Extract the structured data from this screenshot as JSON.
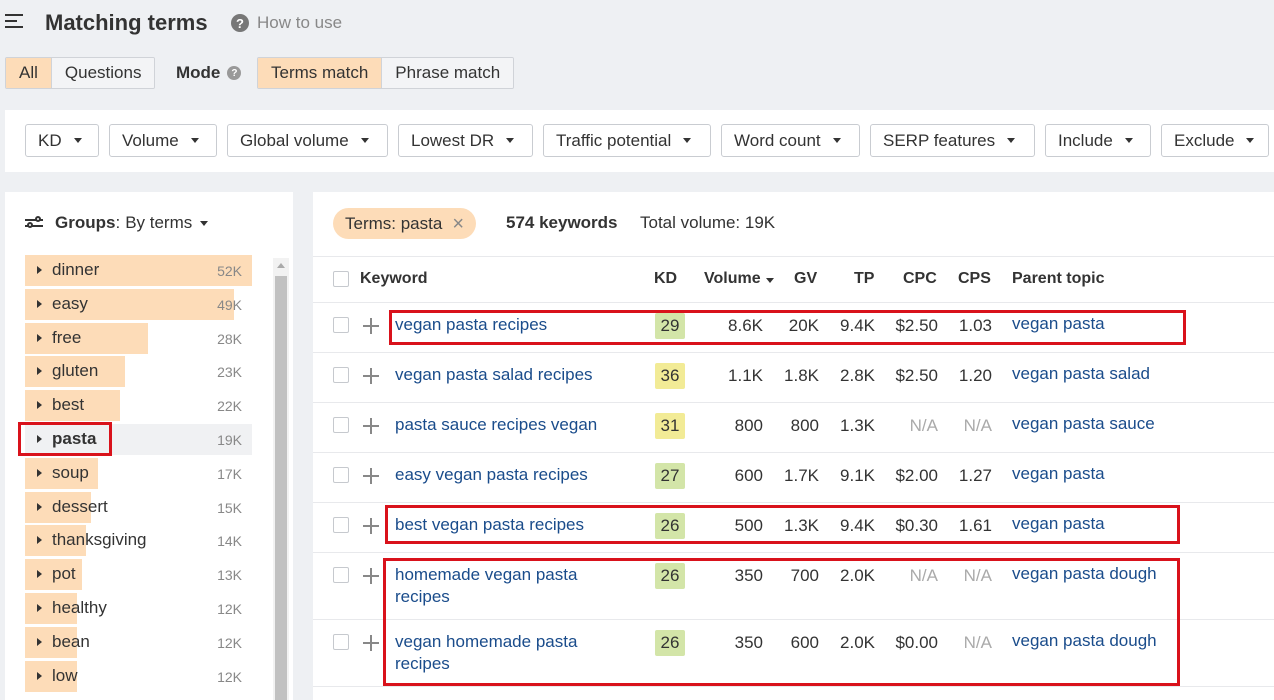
{
  "header": {
    "title": "Matching terms",
    "how_to_use": "How to use"
  },
  "scope_tabs": [
    "All",
    "Questions"
  ],
  "mode": {
    "label": "Mode",
    "options": [
      "Terms match",
      "Phrase match"
    ]
  },
  "filters": [
    "KD",
    "Volume",
    "Global volume",
    "Lowest DR",
    "Traffic potential",
    "Word count",
    "SERP features",
    "Include",
    "Exclude"
  ],
  "groups": {
    "label": "Groups",
    "value": "By terms",
    "items": [
      {
        "name": "dinner",
        "count": "52K",
        "fill": 1.0
      },
      {
        "name": "easy",
        "count": "49K",
        "fill": 0.92
      },
      {
        "name": "free",
        "count": "28K",
        "fill": 0.54
      },
      {
        "name": "gluten",
        "count": "23K",
        "fill": 0.44
      },
      {
        "name": "best",
        "count": "22K",
        "fill": 0.42
      },
      {
        "name": "pasta",
        "count": "19K",
        "fill": 0.37
      },
      {
        "name": "soup",
        "count": "17K",
        "fill": 0.32
      },
      {
        "name": "dessert",
        "count": "15K",
        "fill": 0.29
      },
      {
        "name": "thanksgiving",
        "count": "14K",
        "fill": 0.27
      },
      {
        "name": "pot",
        "count": "13K",
        "fill": 0.25
      },
      {
        "name": "healthy",
        "count": "12K",
        "fill": 0.23
      },
      {
        "name": "bean",
        "count": "12K",
        "fill": 0.23
      },
      {
        "name": "low",
        "count": "12K",
        "fill": 0.23
      }
    ]
  },
  "term_chip": "Terms: pasta",
  "keyword_count": "574 keywords",
  "total_volume": "Total volume: 19K",
  "columns": [
    "Keyword",
    "KD",
    "Volume",
    "GV",
    "TP",
    "CPC",
    "CPS",
    "Parent topic"
  ],
  "rows": [
    {
      "keyword": "vegan pasta recipes",
      "kd": "29",
      "volume": "8.6K",
      "gv": "20K",
      "tp": "9.4K",
      "cpc": "$2.50",
      "cps": "1.03",
      "parent": "vegan pasta"
    },
    {
      "keyword": "vegan pasta salad recipes",
      "kd": "36",
      "volume": "1.1K",
      "gv": "1.8K",
      "tp": "2.8K",
      "cpc": "$2.50",
      "cps": "1.20",
      "parent": "vegan pasta salad"
    },
    {
      "keyword": "pasta sauce recipes vegan",
      "kd": "31",
      "volume": "800",
      "gv": "800",
      "tp": "1.3K",
      "cpc": "N/A",
      "cps": "N/A",
      "parent": "vegan pasta sauce"
    },
    {
      "keyword": "easy vegan pasta recipes",
      "kd": "27",
      "volume": "600",
      "gv": "1.7K",
      "tp": "9.1K",
      "cpc": "$2.00",
      "cps": "1.27",
      "parent": "vegan pasta"
    },
    {
      "keyword": "best vegan pasta recipes",
      "kd": "26",
      "volume": "500",
      "gv": "1.3K",
      "tp": "9.4K",
      "cpc": "$0.30",
      "cps": "1.61",
      "parent": "vegan pasta"
    },
    {
      "keyword": "homemade vegan pasta recipes",
      "kd": "26",
      "volume": "350",
      "gv": "700",
      "tp": "2.0K",
      "cpc": "N/A",
      "cps": "N/A",
      "parent": "vegan pasta dough"
    },
    {
      "keyword": "vegan homemade pasta recipes",
      "kd": "26",
      "volume": "350",
      "gv": "600",
      "tp": "2.0K",
      "cpc": "$0.00",
      "cps": "N/A",
      "parent": "vegan pasta dough"
    }
  ],
  "colors": {
    "accent": "#fddcb8",
    "link": "#1a4c8b",
    "kd_green": "#d3e5a8",
    "kd_yellow": "#f2eb96",
    "highlight": "#d9121b"
  }
}
